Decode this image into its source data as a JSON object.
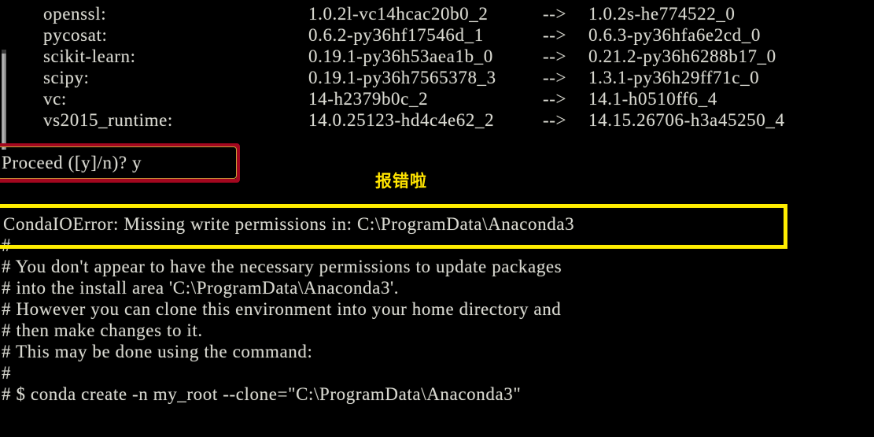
{
  "terminal": {
    "background_color": "#000000",
    "text_color": "#d8d8d0",
    "clipped_top_line": {
      "name": "",
      "from": "",
      "arrow": "",
      "to": ""
    },
    "package_table": {
      "arrow": "-->",
      "rows": [
        {
          "name": "openssl:",
          "from": "1.0.2l-vc14hcac20b0_2",
          "arrow": "-->",
          "to": "1.0.2s-he774522_0"
        },
        {
          "name": "pycosat:",
          "from": "0.6.2-py36hf17546d_1",
          "arrow": "-->",
          "to": "0.6.3-py36hfa6e2cd_0"
        },
        {
          "name": "scikit-learn:",
          "from": "0.19.1-py36h53aea1b_0",
          "arrow": "-->",
          "to": "0.21.2-py36h6288b17_0"
        },
        {
          "name": "scipy:",
          "from": "0.19.1-py36h7565378_3",
          "arrow": "-->",
          "to": "1.3.1-py36h29ff71c_0"
        },
        {
          "name": "vc:",
          "from": "14-h2379b0c_2",
          "arrow": "-->",
          "to": "14.1-h0510ff6_4"
        },
        {
          "name": "vs2015_runtime:",
          "from": "14.0.25123-hd4c4e62_2",
          "arrow": "-->",
          "to": "14.15.26706-h3a45250_4"
        }
      ]
    },
    "prompt": "Proceed ([y]/n)? y",
    "error": "CondaIOError: Missing write permissions in: C:\\ProgramData\\Anaconda3",
    "hash_block": [
      "#",
      "# You don't appear to have the necessary permissions to update packages",
      "# into the install area 'C:\\ProgramData\\Anaconda3'.",
      "# However you can clone this environment into your home directory and",
      "# then make changes to it.",
      "# This may be done using the command:",
      "#",
      "# $ conda create -n my_root --clone=\"C:\\ProgramData\\Anaconda3\""
    ]
  },
  "annotations": {
    "red_box": {
      "label": "proceed-prompt-highlight",
      "color": "#a3071f"
    },
    "yellow_box": {
      "label": "error-message-highlight",
      "color": "#ffee00"
    },
    "chinese_note": {
      "text": "报错啦",
      "color": "#ffe400"
    }
  },
  "scrollbar": {
    "thumb_color": "#b9b9b9",
    "track_color": "#000000"
  }
}
